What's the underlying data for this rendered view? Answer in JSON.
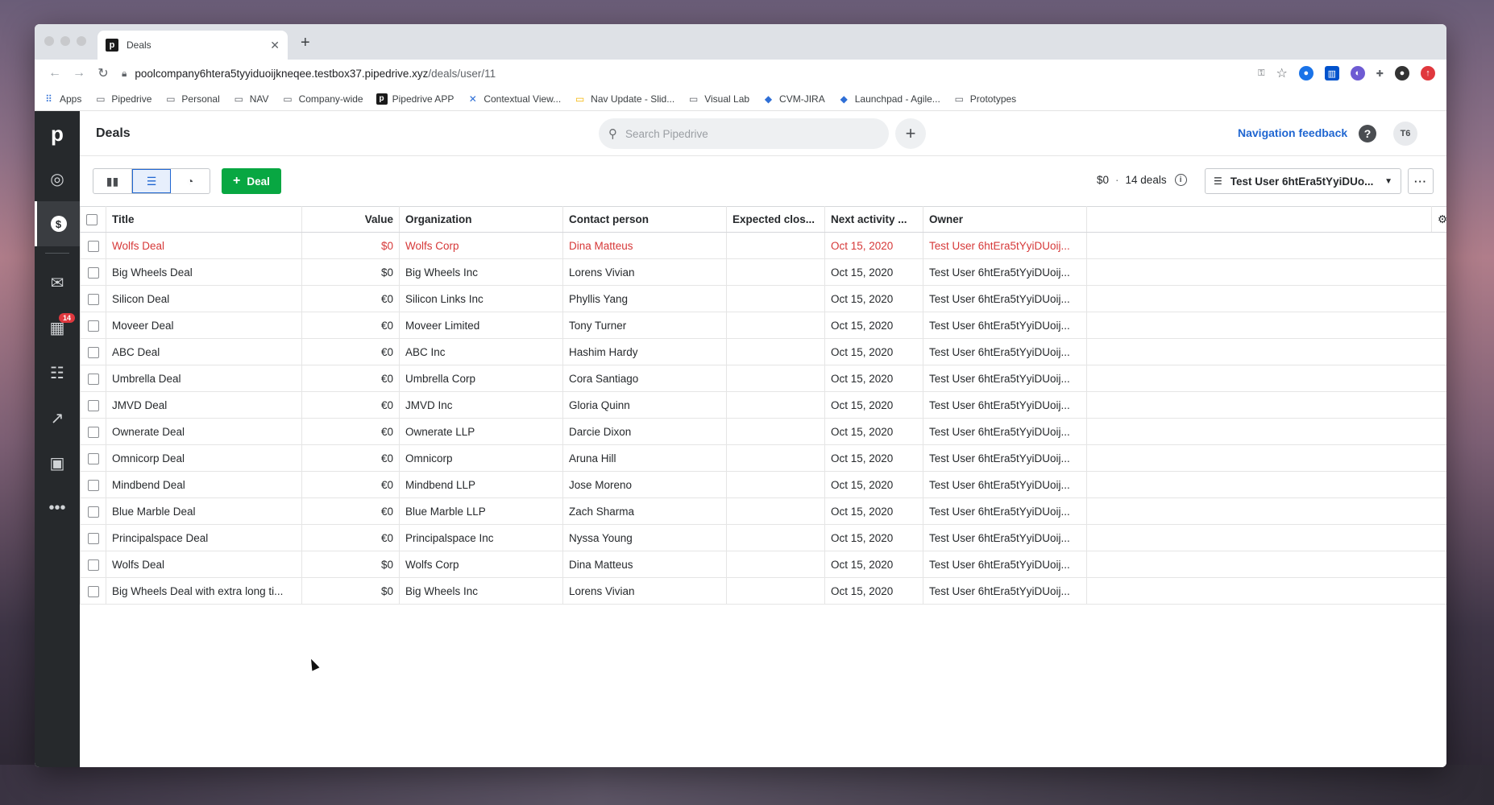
{
  "browser": {
    "tab_title": "Deals",
    "url_main": "poolcompany6htera5tyyiduoijkneqee.testbox37.pipedrive.xyz",
    "url_path": "/deals/user/11",
    "bookmarks": [
      {
        "label": "Apps",
        "icon": "apps-grid-icon"
      },
      {
        "label": "Pipedrive",
        "icon": "folder-icon"
      },
      {
        "label": "Personal",
        "icon": "folder-icon"
      },
      {
        "label": "NAV",
        "icon": "folder-icon"
      },
      {
        "label": "Company-wide",
        "icon": "folder-icon"
      },
      {
        "label": "Pipedrive APP",
        "icon": "pipedrive-icon"
      },
      {
        "label": "Contextual View...",
        "icon": "confluence-icon"
      },
      {
        "label": "Nav Update - Slid...",
        "icon": "slides-icon"
      },
      {
        "label": "Visual Lab",
        "icon": "folder-icon"
      },
      {
        "label": "CVM-JIRA",
        "icon": "jira-icon"
      },
      {
        "label": "Launchpad - Agile...",
        "icon": "jira-icon"
      },
      {
        "label": "Prototypes",
        "icon": "folder-icon"
      }
    ]
  },
  "app": {
    "page_title": "Deals",
    "search_placeholder": "Search Pipedrive",
    "nav_feedback": "Navigation feedback",
    "avatar_initials": "T6",
    "activities_badge": "14",
    "add_deal_label": "Deal",
    "summary_value": "$0",
    "summary_count": "14 deals",
    "filter_label": "Test User 6htEra5tYyiDUo...",
    "accent_green": "#08a742",
    "accent_blue": "#1f66d1"
  },
  "table": {
    "columns": [
      "Title",
      "Value",
      "Organization",
      "Contact person",
      "Expected clos...",
      "Next activity ...",
      "Owner"
    ],
    "rows": [
      {
        "title": "Wolfs Deal",
        "value": "$0",
        "org": "Wolfs Corp",
        "contact": "Dina Matteus",
        "expected": "",
        "next": "Oct 15, 2020",
        "owner": "Test User 6htEra5tYyiDUoij...",
        "overdue": true
      },
      {
        "title": "Big Wheels Deal",
        "value": "$0",
        "org": "Big Wheels Inc",
        "contact": "Lorens Vivian",
        "expected": "",
        "next": "Oct 15, 2020",
        "owner": "Test User 6htEra5tYyiDUoij...",
        "overdue": false
      },
      {
        "title": "Silicon Deal",
        "value": "€0",
        "org": "Silicon Links Inc",
        "contact": "Phyllis Yang",
        "expected": "",
        "next": "Oct 15, 2020",
        "owner": "Test User 6htEra5tYyiDUoij...",
        "overdue": false
      },
      {
        "title": "Moveer Deal",
        "value": "€0",
        "org": "Moveer Limited",
        "contact": "Tony Turner",
        "expected": "",
        "next": "Oct 15, 2020",
        "owner": "Test User 6htEra5tYyiDUoij...",
        "overdue": false
      },
      {
        "title": "ABC Deal",
        "value": "€0",
        "org": "ABC Inc",
        "contact": "Hashim Hardy",
        "expected": "",
        "next": "Oct 15, 2020",
        "owner": "Test User 6htEra5tYyiDUoij...",
        "overdue": false
      },
      {
        "title": "Umbrella Deal",
        "value": "€0",
        "org": "Umbrella Corp",
        "contact": "Cora Santiago",
        "expected": "",
        "next": "Oct 15, 2020",
        "owner": "Test User 6htEra5tYyiDUoij...",
        "overdue": false
      },
      {
        "title": "JMVD Deal",
        "value": "€0",
        "org": "JMVD Inc",
        "contact": "Gloria Quinn",
        "expected": "",
        "next": "Oct 15, 2020",
        "owner": "Test User 6htEra5tYyiDUoij...",
        "overdue": false
      },
      {
        "title": "Ownerate Deal",
        "value": "€0",
        "org": "Ownerate LLP",
        "contact": "Darcie Dixon",
        "expected": "",
        "next": "Oct 15, 2020",
        "owner": "Test User 6htEra5tYyiDUoij...",
        "overdue": false
      },
      {
        "title": "Omnicorp Deal",
        "value": "€0",
        "org": "Omnicorp",
        "contact": "Aruna Hill",
        "expected": "",
        "next": "Oct 15, 2020",
        "owner": "Test User 6htEra5tYyiDUoij...",
        "overdue": false
      },
      {
        "title": "Mindbend Deal",
        "value": "€0",
        "org": "Mindbend LLP",
        "contact": "Jose Moreno",
        "expected": "",
        "next": "Oct 15, 2020",
        "owner": "Test User 6htEra5tYyiDUoij...",
        "overdue": false
      },
      {
        "title": "Blue Marble Deal",
        "value": "€0",
        "org": "Blue Marble LLP",
        "contact": "Zach Sharma",
        "expected": "",
        "next": "Oct 15, 2020",
        "owner": "Test User 6htEra5tYyiDUoij...",
        "overdue": false
      },
      {
        "title": "Principalspace Deal",
        "value": "€0",
        "org": "Principalspace Inc",
        "contact": "Nyssa Young",
        "expected": "",
        "next": "Oct 15, 2020",
        "owner": "Test User 6htEra5tYyiDUoij...",
        "overdue": false
      },
      {
        "title": "Wolfs Deal",
        "value": "$0",
        "org": "Wolfs Corp",
        "contact": "Dina Matteus",
        "expected": "",
        "next": "Oct 15, 2020",
        "owner": "Test User 6htEra5tYyiDUoij...",
        "overdue": false
      },
      {
        "title": "Big Wheels Deal with extra long ti...",
        "value": "$0",
        "org": "Big Wheels Inc",
        "contact": "Lorens Vivian",
        "expected": "",
        "next": "Oct 15, 2020",
        "owner": "Test User 6htEra5tYyiDUoij...",
        "overdue": false
      }
    ]
  }
}
